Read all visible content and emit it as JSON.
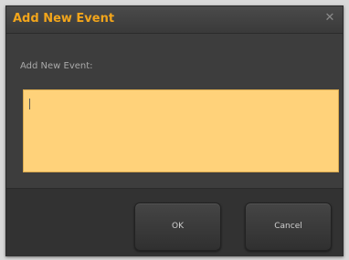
{
  "dialog": {
    "title": "Add New Event",
    "close_icon": "close-icon",
    "field_label": "Add New Event:",
    "input_value": "",
    "ok_label": "OK",
    "cancel_label": "Cancel"
  },
  "colors": {
    "title": "#f2a51b",
    "input_background": "#ffd27a",
    "dialog_background": "#3d3d3d"
  }
}
